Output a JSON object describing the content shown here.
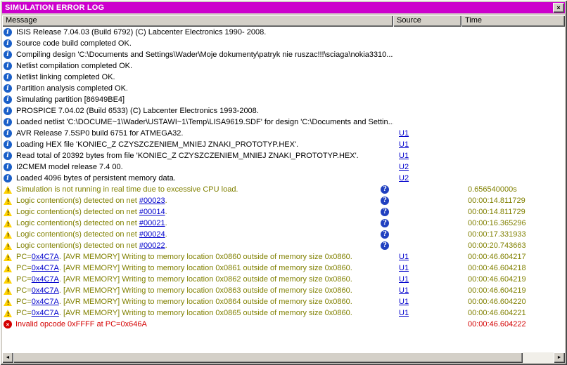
{
  "colors": {
    "titlebar": "#CC00CC",
    "chrome": "#D4D0C8",
    "warning_text": "#808000",
    "error_text": "#D40000",
    "link": "#0000CC",
    "info_icon": "#1A5FC8",
    "question_icon": "#2040C0",
    "warning_icon": "#FFD200",
    "error_icon": "#D40000"
  },
  "window": {
    "title": "SIMULATION ERROR LOG",
    "close_glyph": "×"
  },
  "columns": {
    "message": "Message",
    "source": "Source",
    "time": "Time"
  },
  "icons": {
    "info": "i",
    "warning": "!",
    "error": "×",
    "question": "?",
    "scroll_left": "◄",
    "scroll_right": "►"
  },
  "rows": [
    {
      "icon": "info",
      "tone": "info",
      "pre": "ISIS Release 7.04.03 (Build 6792) (C) Labcenter Electronics 1990- 2008.",
      "link": "",
      "post": "",
      "q": false,
      "source": "",
      "time": ""
    },
    {
      "icon": "info",
      "tone": "info",
      "pre": "Source code build completed OK.",
      "link": "",
      "post": "",
      "q": false,
      "source": "",
      "time": ""
    },
    {
      "icon": "info",
      "tone": "info",
      "pre": "Compiling design 'C:\\Documents and Settings\\Wader\\Moje dokumenty\\patryk nie ruszac!!!\\sciaga\\nokia3310....",
      "link": "",
      "post": "",
      "q": false,
      "source": "",
      "time": ""
    },
    {
      "icon": "info",
      "tone": "info",
      "pre": "Netlist compilation completed OK.",
      "link": "",
      "post": "",
      "q": false,
      "source": "",
      "time": ""
    },
    {
      "icon": "info",
      "tone": "info",
      "pre": "Netlist linking completed OK.",
      "link": "",
      "post": "",
      "q": false,
      "source": "",
      "time": ""
    },
    {
      "icon": "info",
      "tone": "info",
      "pre": "Partition analysis completed OK.",
      "link": "",
      "post": "",
      "q": false,
      "source": "",
      "time": ""
    },
    {
      "icon": "info",
      "tone": "info",
      "pre": "Simulating partition [86949BE4]",
      "link": "",
      "post": "",
      "q": false,
      "source": "",
      "time": ""
    },
    {
      "icon": "info",
      "tone": "info",
      "pre": "PROSPICE 7.04.02 (Build 6533) (C) Labcenter Electronics 1993-2008.",
      "link": "",
      "post": "",
      "q": false,
      "source": "",
      "time": ""
    },
    {
      "icon": "info",
      "tone": "info",
      "pre": "Loaded netlist 'C:\\DOCUME~1\\Wader\\USTAWI~1\\Temp\\LISA9619.SDF' for design 'C:\\Documents and Settin...",
      "link": "",
      "post": "",
      "q": false,
      "source": "",
      "time": ""
    },
    {
      "icon": "info",
      "tone": "info",
      "pre": "AVR Release 7.5SP0 build 6751 for ATMEGA32.",
      "link": "",
      "post": "",
      "q": false,
      "source": "U1",
      "time": ""
    },
    {
      "icon": "info",
      "tone": "info",
      "pre": "Loading HEX file 'KONIEC_Z CZYSZCZENIEM_MNIEJ ZNAKI_PROTOTYP.HEX'.",
      "link": "",
      "post": "",
      "q": false,
      "source": "U1",
      "time": ""
    },
    {
      "icon": "info",
      "tone": "info",
      "pre": "Read total of 20392 bytes from file 'KONIEC_Z CZYSZCZENIEM_MNIEJ ZNAKI_PROTOTYP.HEX'.",
      "link": "",
      "post": "",
      "q": false,
      "source": "U1",
      "time": ""
    },
    {
      "icon": "info",
      "tone": "info",
      "pre": "I2CMEM model release 7.4 00.",
      "link": "",
      "post": "",
      "q": false,
      "source": "U2",
      "time": ""
    },
    {
      "icon": "info",
      "tone": "info",
      "pre": "Loaded 4096 bytes of persistent memory data.",
      "link": "",
      "post": "",
      "q": false,
      "source": "U2",
      "time": ""
    },
    {
      "icon": "warning",
      "tone": "warn",
      "pre": "Simulation is not running in real time due to excessive CPU load.",
      "link": "",
      "post": "",
      "q": true,
      "source": "",
      "time": "0.656540000s"
    },
    {
      "icon": "warning",
      "tone": "warn",
      "pre": "Logic contention(s) detected on net ",
      "link": "#00023",
      "post": ".",
      "q": true,
      "source": "",
      "time": "00:00:14.811729"
    },
    {
      "icon": "warning",
      "tone": "warn",
      "pre": "Logic contention(s) detected on net ",
      "link": "#00014",
      "post": ".",
      "q": true,
      "source": "",
      "time": "00:00:14.811729"
    },
    {
      "icon": "warning",
      "tone": "warn",
      "pre": "Logic contention(s) detected on net ",
      "link": "#00021",
      "post": ".",
      "q": true,
      "source": "",
      "time": "00:00:16.365296"
    },
    {
      "icon": "warning",
      "tone": "warn",
      "pre": "Logic contention(s) detected on net ",
      "link": "#00024",
      "post": ".",
      "q": true,
      "source": "",
      "time": "00:00:17.331933"
    },
    {
      "icon": "warning",
      "tone": "warn",
      "pre": "Logic contention(s) detected on net ",
      "link": "#00022",
      "post": ".",
      "q": true,
      "source": "",
      "time": "00:00:20.743663"
    },
    {
      "icon": "warning",
      "tone": "warn",
      "pre": "PC=",
      "link": "0x4C7A",
      "post": ". [AVR MEMORY] Writing to memory location 0x0860 outside of memory size 0x0860.",
      "q": false,
      "source": "U1",
      "time": "00:00:46.604217"
    },
    {
      "icon": "warning",
      "tone": "warn",
      "pre": "PC=",
      "link": "0x4C7A",
      "post": ". [AVR MEMORY] Writing to memory location 0x0861 outside of memory size 0x0860.",
      "q": false,
      "source": "U1",
      "time": "00:00:46.604218"
    },
    {
      "icon": "warning",
      "tone": "warn",
      "pre": "PC=",
      "link": "0x4C7A",
      "post": ". [AVR MEMORY] Writing to memory location 0x0862 outside of memory size 0x0860.",
      "q": false,
      "source": "U1",
      "time": "00:00:46.604219"
    },
    {
      "icon": "warning",
      "tone": "warn",
      "pre": "PC=",
      "link": "0x4C7A",
      "post": ". [AVR MEMORY] Writing to memory location 0x0863 outside of memory size 0x0860.",
      "q": false,
      "source": "U1",
      "time": "00:00:46.604219"
    },
    {
      "icon": "warning",
      "tone": "warn",
      "pre": "PC=",
      "link": "0x4C7A",
      "post": ". [AVR MEMORY] Writing to memory location 0x0864 outside of memory size 0x0860.",
      "q": false,
      "source": "U1",
      "time": "00:00:46.604220"
    },
    {
      "icon": "warning",
      "tone": "warn",
      "pre": "PC=",
      "link": "0x4C7A",
      "post": ". [AVR MEMORY] Writing to memory location 0x0865 outside of memory size 0x0860.",
      "q": false,
      "source": "U1",
      "time": "00:00:46.604221"
    },
    {
      "icon": "error",
      "tone": "error",
      "pre": "Invalid opcode 0xFFFF at PC=0x646A",
      "link": "",
      "post": "",
      "q": false,
      "source": "",
      "time": "00:00:46.604222"
    }
  ]
}
